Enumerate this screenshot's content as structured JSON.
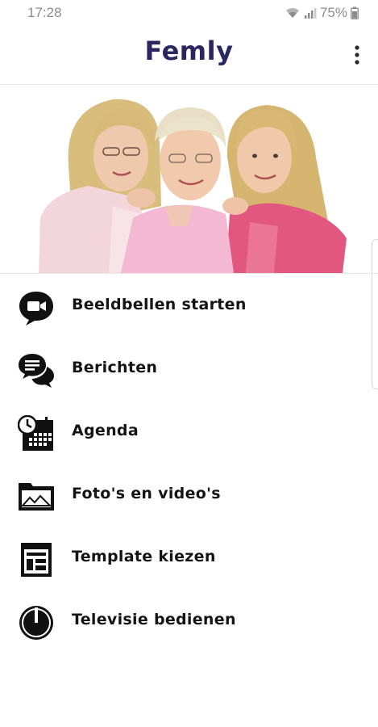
{
  "status_bar": {
    "time": "17:28",
    "battery": "75%"
  },
  "app_bar": {
    "title": "Femly",
    "menu_icon": "more-vert-icon"
  },
  "menu": {
    "items": [
      {
        "label": "Beeldbellen starten",
        "icon": "video-call-icon"
      },
      {
        "label": "Berichten",
        "icon": "chat-icon"
      },
      {
        "label": "Agenda",
        "icon": "calendar-clock-icon"
      },
      {
        "label": "Foto's en video's",
        "icon": "photo-folder-icon"
      },
      {
        "label": "Template kiezen",
        "icon": "template-icon"
      },
      {
        "label": "Televisie bedienen",
        "icon": "power-icon"
      }
    ]
  },
  "colors": {
    "title": "#2a2760",
    "text": "#141414",
    "status": "#8c8c8c"
  }
}
